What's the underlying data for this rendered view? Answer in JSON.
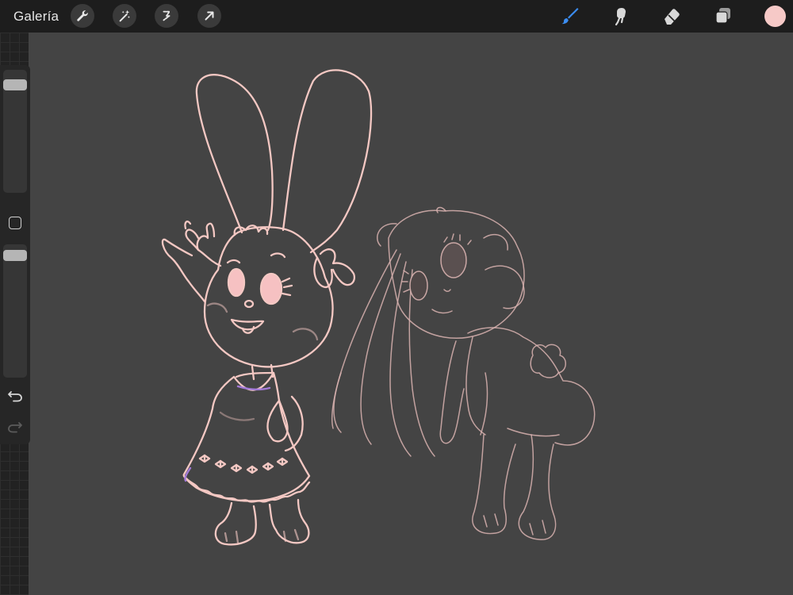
{
  "topbar": {
    "gallery_label": "Galería",
    "icons": [
      "wrench-icon",
      "magic-wand-icon",
      "selection-icon",
      "transform-arrow-icon"
    ],
    "right_tools": [
      "brush-icon",
      "smudge-icon",
      "eraser-icon",
      "layers-icon"
    ],
    "active_tool": "brush-icon",
    "current_color": "#f6c9c7",
    "accent_color": "#3b8df2"
  },
  "sidebar": {
    "size_slider_level": 0.92,
    "opacity_slider_level": 0.96,
    "undo_icon": "undo-icon",
    "redo_icon": "redo-icon",
    "modify_icon": "modify-square-icon"
  },
  "canvas": {
    "background": "#444444",
    "stroke_color": "#f4c8c3"
  }
}
